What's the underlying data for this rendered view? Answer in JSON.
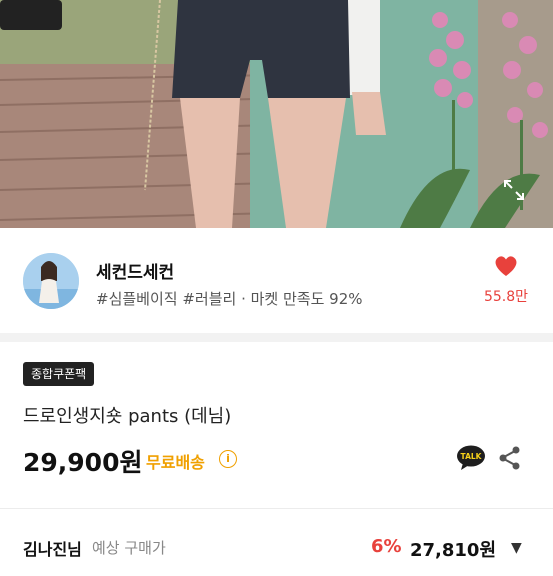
{
  "hero": {
    "image_alt": "product-photo",
    "expand_icon": "expand-icon"
  },
  "seller": {
    "name": "세컨드세컨",
    "tags": "#심플베이직 #러블리 · 마켓 만족도 92%",
    "avatar_icon": "avatar",
    "like_icon": "heart-icon",
    "like_count": "55.8만"
  },
  "product": {
    "badge": "종합쿠폰팩",
    "title": "드로인생지숏 pants (데님)",
    "price": "29,900원",
    "shipping": "무료배송",
    "info_icon": "info-icon",
    "talk_icon": "kakao-talk-icon",
    "talk_label": "TALK",
    "share_icon": "share-icon"
  },
  "promo": {
    "prefix": "김나진님",
    "label": "예상 구매가",
    "rate": "6%",
    "price": "27,810원",
    "chevron_icon": "chevron-down-icon"
  },
  "colors": {
    "accent_red": "#e8413c",
    "shipping_orange": "#f0a000",
    "badge_bg": "#222222"
  }
}
